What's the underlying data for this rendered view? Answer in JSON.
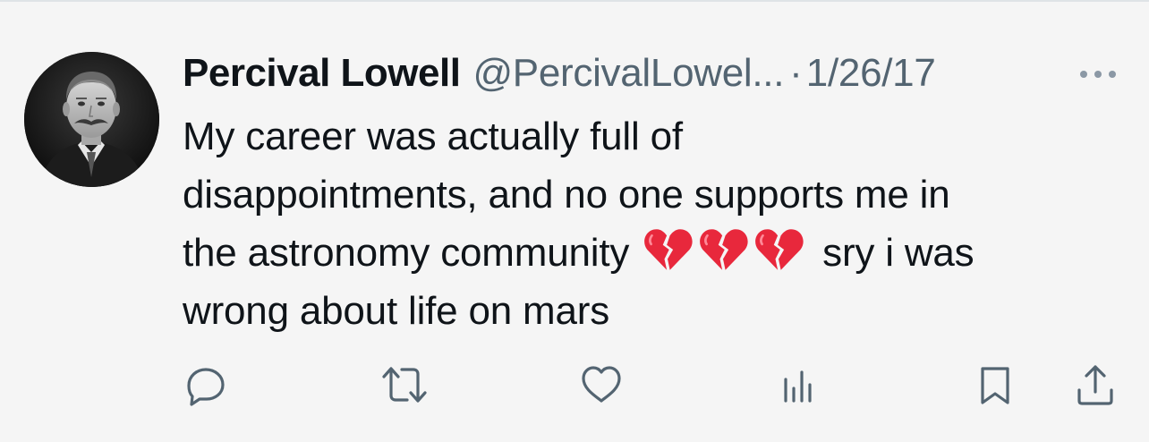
{
  "tweet": {
    "display_name": "Percival Lowell",
    "handle": "@PercivalLowel...",
    "separator": "·",
    "date": "1/26/17",
    "text_part1": "My career was actually full of\ndisappointments, and no one supports me in\nthe astronomy community",
    "text_part2": "sry i was\nwrong about life on mars",
    "emoji": [
      "broken-heart-icon",
      "broken-heart-icon",
      "broken-heart-icon"
    ]
  },
  "actions": [
    {
      "name": "reply",
      "icon": "reply-icon"
    },
    {
      "name": "retweet",
      "icon": "retweet-icon"
    },
    {
      "name": "like",
      "icon": "heart-icon"
    },
    {
      "name": "views",
      "icon": "analytics-icon"
    },
    {
      "name": "bookmark",
      "icon": "bookmark-icon"
    },
    {
      "name": "share",
      "icon": "share-icon"
    }
  ],
  "colors": {
    "background": "#f5f5f5",
    "text_primary": "#0f1419",
    "text_secondary": "#536471",
    "broken_heart": "#e8283c"
  }
}
